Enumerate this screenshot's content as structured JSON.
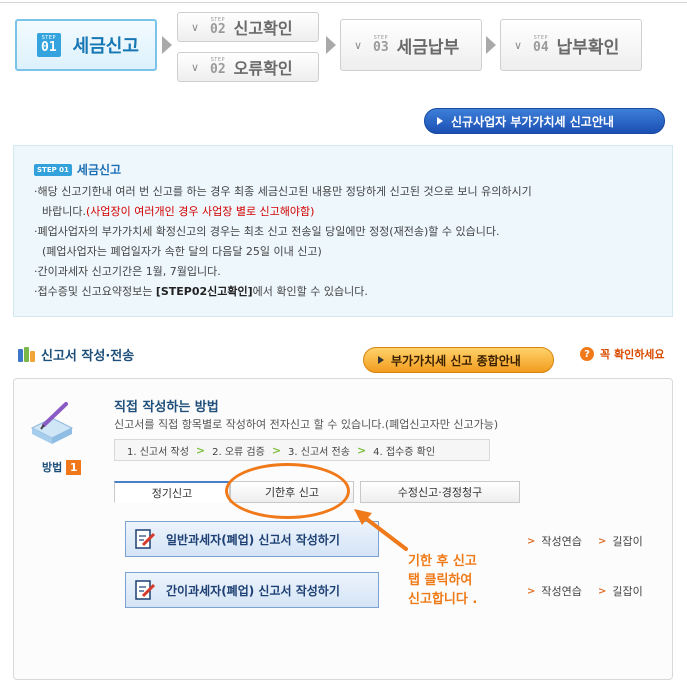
{
  "steps": {
    "step1": {
      "tag": "STEP",
      "num": "01",
      "label": "세금신고"
    },
    "step2a": {
      "tag": "STEP",
      "num": "02",
      "label": "신고확인"
    },
    "step2b": {
      "tag": "STEP",
      "num": "02",
      "label": "오류확인"
    },
    "step3": {
      "tag": "STEP",
      "num": "03",
      "label": "세금납부"
    },
    "step4": {
      "tag": "STEP",
      "num": "04",
      "label": "납부확인"
    }
  },
  "guide_button": "신규사업자 부가가치세 신고안내",
  "info": {
    "badge": "STEP 01",
    "title": "세금신고",
    "line1": "·해당 신고기한내 여러 번 신고를 하는 경우 최종 세금신고된 내용만 정당하게 신고된 것으로 보니 유의하시기",
    "line2a": "바랍니다.",
    "line2b": "(사업장이 여러개인 경우 사업장 별로 신고해야함)",
    "line3": "·폐업사업자의 부가가치세 확정신고의 경우는 최초 신고 전송일 당일에만 정정(재전송)할 수 있습니다.",
    "line4": "(폐업사업자는 폐업일자가 속한 달의 다음달 25일 이내 신고)",
    "line5": "·간이과세자 신고기간은 1월, 7월입니다.",
    "line6a": "·접수증및 신고요약정보는 ",
    "line6b": "[STEP02신고확인]",
    "line6c": "에서 확인할 수 있습니다."
  },
  "section": {
    "title": "신고서 작성·전송",
    "summary_button": "부가가치세 신고 종합안내",
    "help": "꼭 확인하세요"
  },
  "method": {
    "label": "방법",
    "num": "1",
    "title": "직접 작성하는 방법",
    "desc": "신고서를 직접 항목별로 작성하여 전자신고 할 수 있습니다.(폐업신고자만 신고가능)",
    "flow": [
      "1. 신고서 작성",
      "2. 오류 검증",
      "3. 신고서 전송",
      "4. 접수증 확인"
    ]
  },
  "tabs": [
    "정기신고",
    "기한후 신고",
    "수정신고·경정청구"
  ],
  "write_buttons": {
    "general": "일반과세자(폐업) 신고서 작성하기",
    "simple": "간이과세자(폐업) 신고서 작성하기"
  },
  "side_links": {
    "practice": "작성연습",
    "guide": "길잡이"
  },
  "callout": [
    "기한 후 신고",
    "탭 클릭하여",
    "신고합니다 ."
  ],
  "colors": {
    "accent_blue": "#1777b4",
    "orange": "#f07a1a",
    "red": "#d30000"
  }
}
